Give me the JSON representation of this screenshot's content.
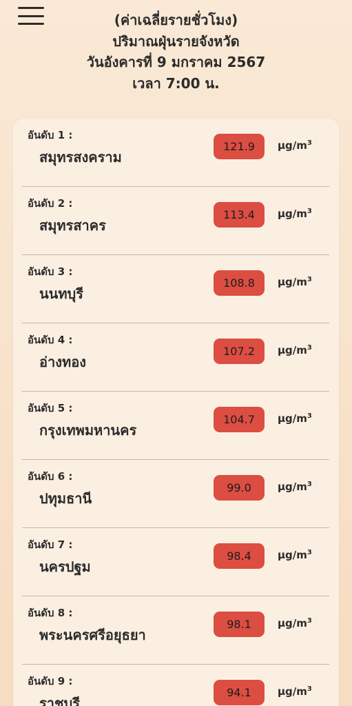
{
  "header": {
    "line1": "(ค่าเฉลี่ยรายชั่วโมง)",
    "line2": "ปริมาณฝุ่นรายจังหวัด",
    "line3": "วันอังคารที่ 9 มกราคม 2567",
    "line4": "เวลา 7:00 น."
  },
  "unit": {
    "base": "μg/m",
    "exp": "3"
  },
  "rankings": [
    {
      "rank_label": "อันดับ 1 :",
      "province": "สมุทรสงคราม",
      "value": "121.9"
    },
    {
      "rank_label": "อันดับ 2 :",
      "province": "สมุทรสาคร",
      "value": "113.4"
    },
    {
      "rank_label": "อันดับ 3 :",
      "province": "นนทบุรี",
      "value": "108.8"
    },
    {
      "rank_label": "อันดับ 4 :",
      "province": "อ่างทอง",
      "value": "107.2"
    },
    {
      "rank_label": "อันดับ 5 :",
      "province": "กรุงเทพมหานคร",
      "value": "104.7"
    },
    {
      "rank_label": "อันดับ 6 :",
      "province": "ปทุมธานี",
      "value": "99.0"
    },
    {
      "rank_label": "อันดับ 7 :",
      "province": "นครปฐม",
      "value": "98.4"
    },
    {
      "rank_label": "อันดับ 8 :",
      "province": "พระนครศรีอยุธยา",
      "value": "98.1"
    },
    {
      "rank_label": "อันดับ 9 :",
      "province": "ราชบุรี",
      "value": "94.1"
    }
  ],
  "colors": {
    "background": "#f9e9d6",
    "card": "#fbefe2",
    "value_pill": "#dc4d42",
    "text": "#2b2b2b"
  },
  "icons": {
    "menu": "hamburger-menu-icon"
  }
}
